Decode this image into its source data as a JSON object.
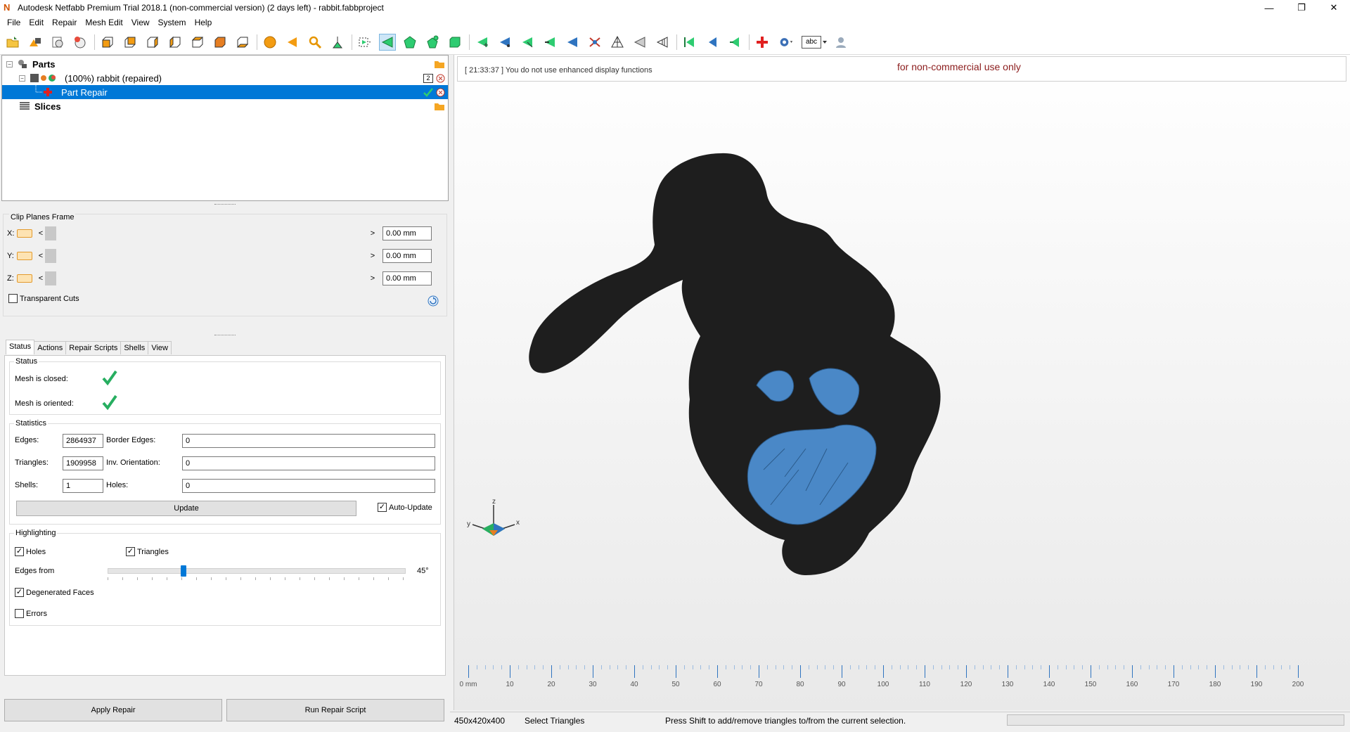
{
  "window": {
    "title": "Autodesk Netfabb Premium Trial 2018.1 (non-commercial version) (2 days left) - rabbit.fabbproject",
    "logo_letter": "N",
    "minimize": "—",
    "restore": "❐",
    "close": "✕"
  },
  "menu": [
    "File",
    "Edit",
    "Repair",
    "Mesh Edit",
    "View",
    "System",
    "Help"
  ],
  "tree": {
    "parts_label": "Parts",
    "part_label": "(100%) rabbit (repaired)",
    "part_badge": "2",
    "repair_label": "Part Repair",
    "slices_label": "Slices"
  },
  "clip_planes": {
    "title": "Clip Planes Frame",
    "rows": [
      {
        "axis": "X:",
        "value": "0.00 mm"
      },
      {
        "axis": "Y:",
        "value": "0.00 mm"
      },
      {
        "axis": "Z:",
        "value": "0.00 mm"
      }
    ],
    "left_arrow": "<",
    "right_arrow": ">",
    "transparent_cuts_label": "Transparent Cuts",
    "transparent_cuts_checked": false
  },
  "tabs": [
    "Status",
    "Actions",
    "Repair Scripts",
    "Shells",
    "View"
  ],
  "active_tab": "Status",
  "status": {
    "title": "Status",
    "mesh_closed_label": "Mesh is closed:",
    "mesh_closed": true,
    "mesh_oriented_label": "Mesh is oriented:",
    "mesh_oriented": true
  },
  "statistics": {
    "title": "Statistics",
    "edges_label": "Edges:",
    "edges": "2864937",
    "border_edges_label": "Border Edges:",
    "border_edges": "0",
    "triangles_label": "Triangles:",
    "triangles": "1909958",
    "inv_orientation_label": "Inv. Orientation:",
    "inv_orientation": "0",
    "shells_label": "Shells:",
    "shells": "1",
    "holes_label": "Holes:",
    "holes": "0",
    "update_label": "Update",
    "auto_update_label": "Auto-Update",
    "auto_update_checked": true
  },
  "highlighting": {
    "title": "Highlighting",
    "holes_label": "Holes",
    "holes_checked": true,
    "triangles_label": "Triangles",
    "triangles_checked": true,
    "edges_from_label": "Edges from",
    "edges_from_value": "45°",
    "edges_from_fraction": 0.25,
    "degenerated_label": "Degenerated Faces",
    "degenerated_checked": true,
    "errors_label": "Errors",
    "errors_checked": false
  },
  "buttons": {
    "apply_repair": "Apply Repair",
    "run_repair_script": "Run Repair Script"
  },
  "viewport": {
    "log_message": "[ 21:33:37 ] You do not use enhanced display functions",
    "watermark": "for non-commercial use only",
    "axis_x": "x",
    "axis_y": "y",
    "axis_z": "z",
    "mesh_color": "#1e1e1e",
    "repair_color": "#4a88c7"
  },
  "ruler": {
    "labels": [
      "0 mm",
      "10",
      "20",
      "30",
      "40",
      "50",
      "60",
      "70",
      "80",
      "90",
      "100",
      "110",
      "120",
      "130",
      "140",
      "150",
      "160",
      "170",
      "180",
      "190",
      "200"
    ]
  },
  "statusbar": {
    "dimensions": "450x420x400",
    "mode": "Select Triangles",
    "hint": "Press Shift to add/remove triangles to/from the current selection."
  }
}
